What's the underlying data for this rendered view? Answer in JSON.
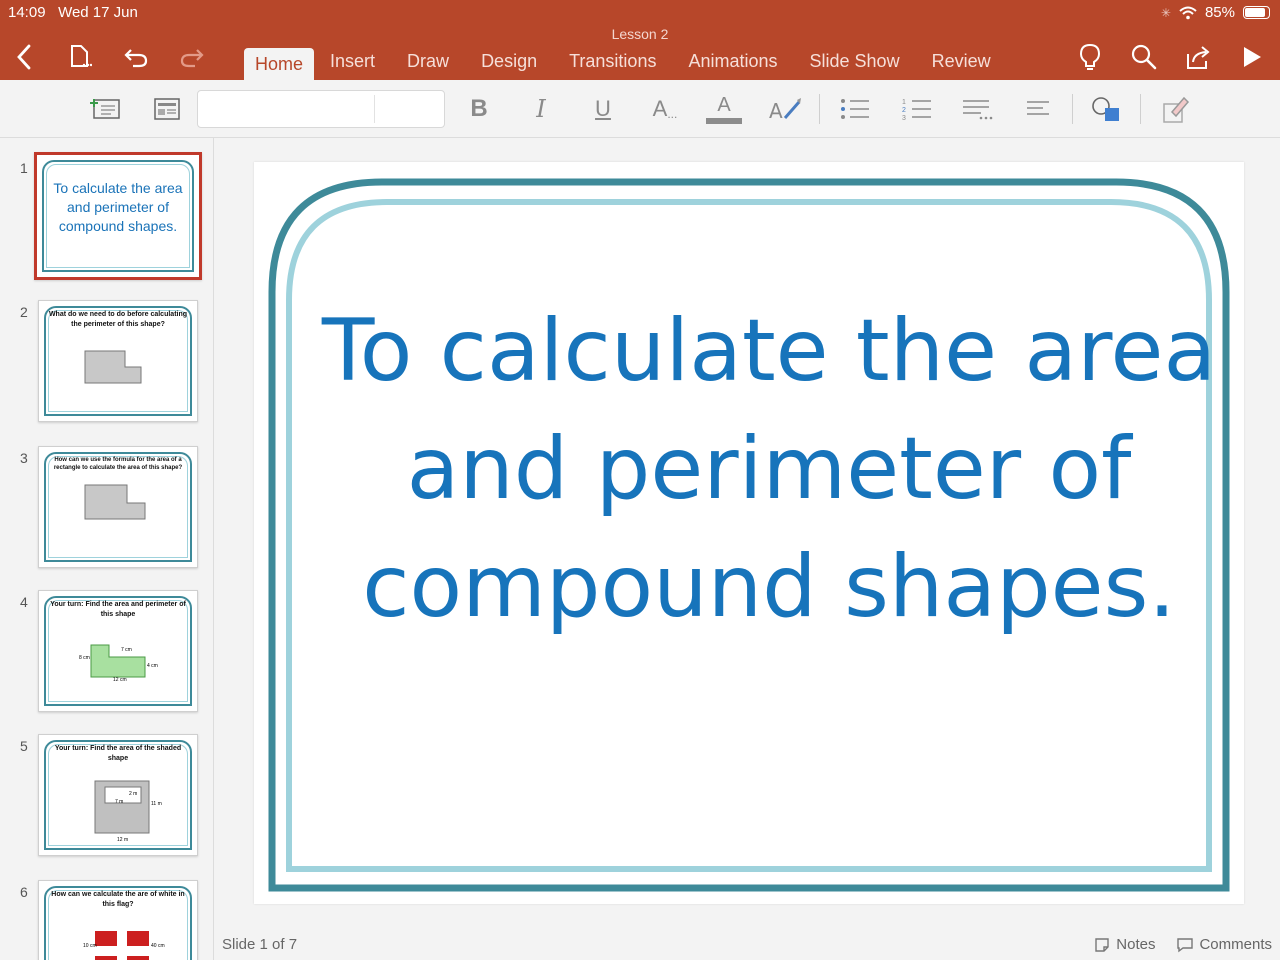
{
  "status_bar": {
    "time": "14:09",
    "date": "Wed 17 Jun",
    "battery": "85%"
  },
  "document": {
    "title": "Lesson 2"
  },
  "tabs": [
    {
      "label": "Home",
      "active": true
    },
    {
      "label": "Insert",
      "active": false
    },
    {
      "label": "Draw",
      "active": false
    },
    {
      "label": "Design",
      "active": false
    },
    {
      "label": "Transitions",
      "active": false
    },
    {
      "label": "Animations",
      "active": false
    },
    {
      "label": "Slide Show",
      "active": false
    },
    {
      "label": "Review",
      "active": false
    }
  ],
  "toolbar": {
    "bold": "B",
    "italic": "I",
    "underline": "U",
    "font_size_label": "A",
    "font_color_label": "A"
  },
  "slides": [
    {
      "number": "1",
      "title": "To calculate the area and perimeter of compound shapes."
    },
    {
      "number": "2",
      "title": "What do we need to do before calculating the perimeter of this shape?"
    },
    {
      "number": "3",
      "title": "How can we use the formula for the area of a rectangle to calculate the area of this shape?"
    },
    {
      "number": "4",
      "title": "Your turn: Find the area and perimeter of this shape",
      "labels": [
        "7 cm",
        "8 cm",
        "4 cm",
        "12 cm"
      ]
    },
    {
      "number": "5",
      "title": "Your turn: Find the area of the shaded shape",
      "labels": [
        "2 m",
        "7 m",
        "11 m",
        "12 m"
      ]
    },
    {
      "number": "6",
      "title": "How can we calculate the are of white in this flag?",
      "labels": [
        "10 cm",
        "40 cm"
      ]
    }
  ],
  "main_slide": {
    "title": "To calculate the area and perimeter of compound shapes."
  },
  "footer": {
    "slide_indicator": "Slide 1 of 7",
    "notes": "Notes",
    "comments": "Comments"
  },
  "colors": {
    "ribbon": "#b7472a",
    "accent_text": "#1774bb",
    "frame_outer": "#3e8a99",
    "frame_inner": "#9ed2dc",
    "selection": "#c0392b"
  }
}
